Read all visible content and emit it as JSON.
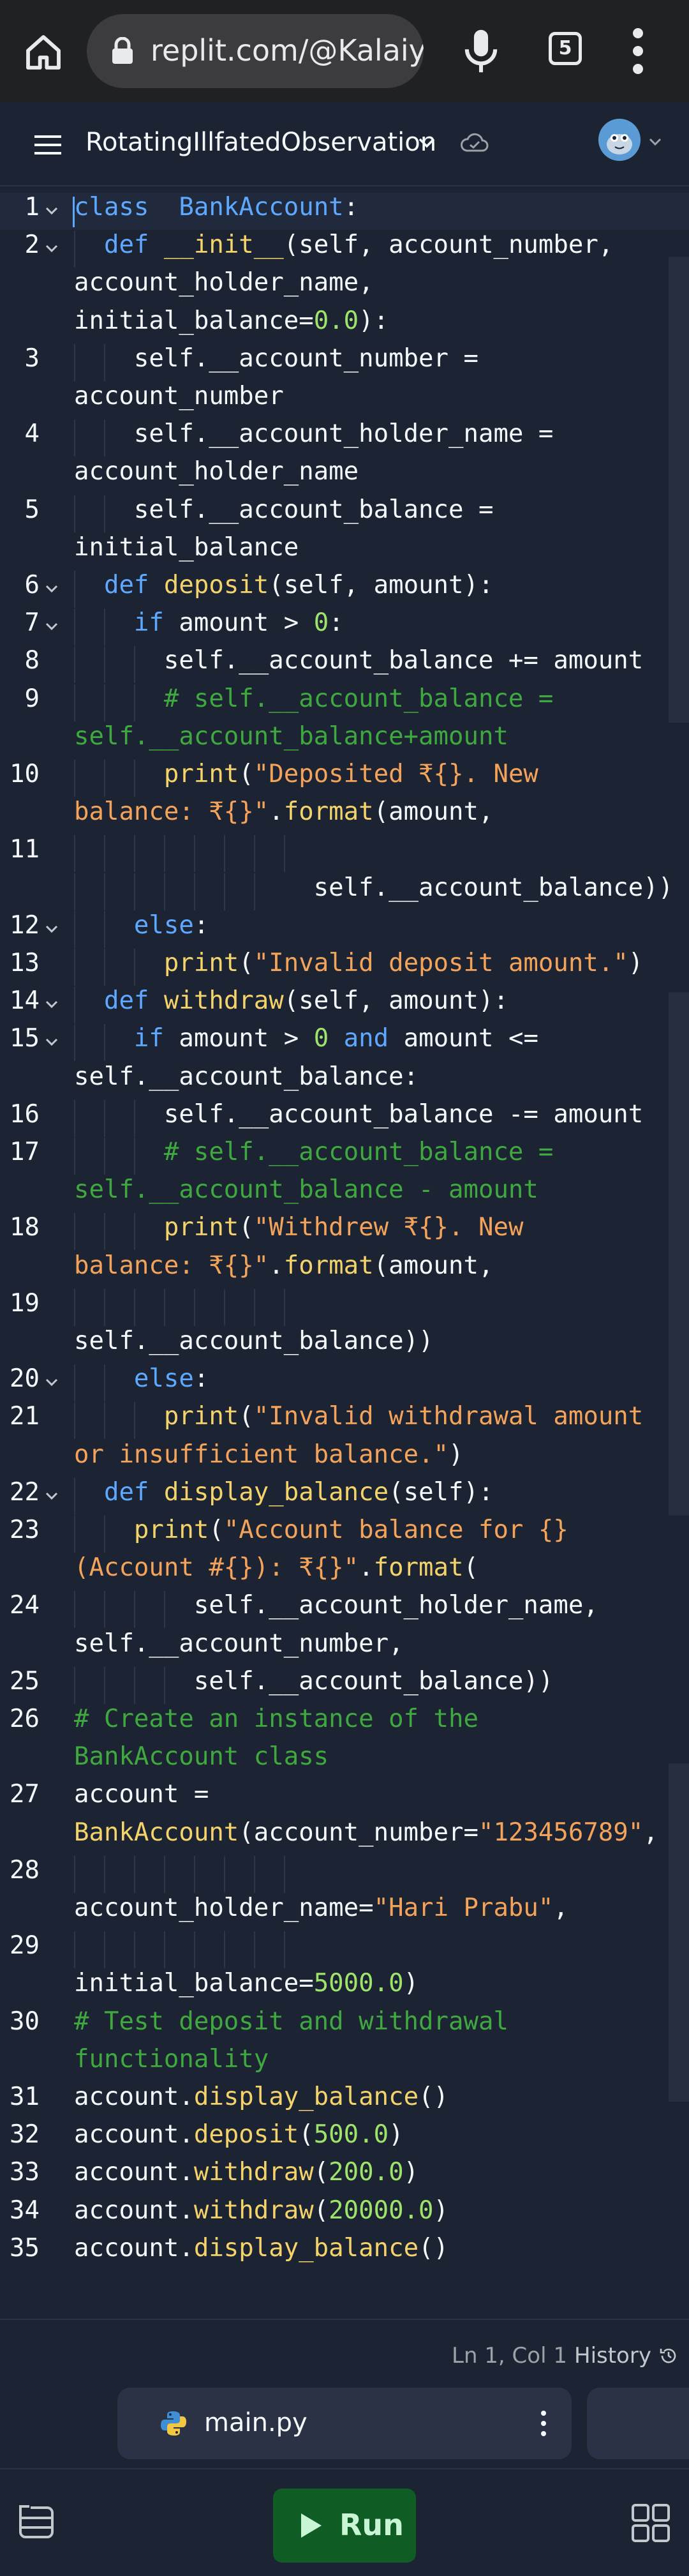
{
  "browser": {
    "url": "replit.com/@Kalaiya",
    "tab_count": "5",
    "icons": [
      "home-icon",
      "lock-icon",
      "mic-icon",
      "tabs-icon",
      "more-vert-icon"
    ]
  },
  "header": {
    "repl_name": "RotatingIllfatedObservation",
    "icons": [
      "hamburger-menu-icon",
      "chevron-down-icon",
      "cloud-sync-icon",
      "avatar"
    ]
  },
  "editor": {
    "lines": [
      {
        "n": "1",
        "fold": true,
        "indent": 0,
        "tokens": [
          [
            "kw",
            "class"
          ],
          [
            "",
            "  "
          ],
          [
            "cls",
            "BankAccount"
          ],
          [
            "",
            ":"
          ]
        ]
      },
      {
        "n": "2",
        "fold": true,
        "indent": 1,
        "tokens": [
          [
            "",
            "  "
          ],
          [
            "kw",
            "def"
          ],
          [
            "",
            " "
          ],
          [
            "fn",
            "__init__"
          ],
          [
            "",
            "(self, account_number,"
          ]
        ]
      },
      {
        "n": "",
        "fold": false,
        "indent": 0,
        "tokens": [
          [
            "",
            "account_holder_name,"
          ]
        ]
      },
      {
        "n": "",
        "fold": false,
        "indent": 0,
        "tokens": [
          [
            "",
            "initial_balance="
          ],
          [
            "num",
            "0.0"
          ],
          [
            "",
            "):"
          ]
        ]
      },
      {
        "n": "3",
        "fold": false,
        "indent": 2,
        "tokens": [
          [
            "",
            "    self.__account_number ="
          ]
        ]
      },
      {
        "n": "",
        "fold": false,
        "indent": 0,
        "tokens": [
          [
            "",
            "account_number"
          ]
        ]
      },
      {
        "n": "4",
        "fold": false,
        "indent": 2,
        "tokens": [
          [
            "",
            "    self.__account_holder_name ="
          ]
        ]
      },
      {
        "n": "",
        "fold": false,
        "indent": 0,
        "tokens": [
          [
            "",
            "account_holder_name"
          ]
        ]
      },
      {
        "n": "5",
        "fold": false,
        "indent": 2,
        "tokens": [
          [
            "",
            "    self.__account_balance ="
          ]
        ]
      },
      {
        "n": "",
        "fold": false,
        "indent": 0,
        "tokens": [
          [
            "",
            "initial_balance"
          ]
        ]
      },
      {
        "n": "6",
        "fold": true,
        "indent": 1,
        "tokens": [
          [
            "",
            "  "
          ],
          [
            "kw",
            "def"
          ],
          [
            "",
            " "
          ],
          [
            "fn",
            "deposit"
          ],
          [
            "",
            "(self, amount):"
          ]
        ]
      },
      {
        "n": "7",
        "fold": true,
        "indent": 2,
        "tokens": [
          [
            "",
            "    "
          ],
          [
            "kw",
            "if"
          ],
          [
            "",
            " amount > "
          ],
          [
            "num",
            "0"
          ],
          [
            "",
            ":"
          ]
        ]
      },
      {
        "n": "8",
        "fold": false,
        "indent": 3,
        "tokens": [
          [
            "",
            "      self.__account_balance += amount"
          ]
        ]
      },
      {
        "n": "9",
        "fold": false,
        "indent": 3,
        "tokens": [
          [
            "",
            "      "
          ],
          [
            "com",
            "# self.__account_balance ="
          ]
        ]
      },
      {
        "n": "",
        "fold": false,
        "indent": 0,
        "tokens": [
          [
            "com",
            "self.__account_balance+amount"
          ]
        ]
      },
      {
        "n": "10",
        "fold": false,
        "indent": 3,
        "tokens": [
          [
            "",
            "      "
          ],
          [
            "fn",
            "print"
          ],
          [
            "",
            "("
          ],
          [
            "str",
            "\"Deposited ₹{}. New"
          ]
        ]
      },
      {
        "n": "",
        "fold": false,
        "indent": 0,
        "tokens": [
          [
            "str",
            "balance: ₹{}\""
          ],
          [
            "",
            "."
          ],
          [
            "fn",
            "format"
          ],
          [
            "",
            "(amount,"
          ]
        ]
      },
      {
        "n": "11",
        "fold": false,
        "indent": 8,
        "tokens": []
      },
      {
        "n": "",
        "fold": false,
        "indent": 7,
        "tokens": [
          [
            "",
            "                self.__account_balance))"
          ]
        ]
      },
      {
        "n": "12",
        "fold": true,
        "indent": 2,
        "tokens": [
          [
            "",
            "    "
          ],
          [
            "kw",
            "else"
          ],
          [
            "",
            ":"
          ]
        ]
      },
      {
        "n": "13",
        "fold": false,
        "indent": 3,
        "tokens": [
          [
            "",
            "      "
          ],
          [
            "fn",
            "print"
          ],
          [
            "",
            "("
          ],
          [
            "str",
            "\"Invalid deposit amount.\""
          ],
          [
            "",
            ")"
          ]
        ]
      },
      {
        "n": "14",
        "fold": true,
        "indent": 1,
        "tokens": [
          [
            "",
            "  "
          ],
          [
            "kw",
            "def"
          ],
          [
            "",
            " "
          ],
          [
            "fn",
            "withdraw"
          ],
          [
            "",
            "(self, amount):"
          ]
        ]
      },
      {
        "n": "15",
        "fold": true,
        "indent": 2,
        "tokens": [
          [
            "",
            "    "
          ],
          [
            "kw",
            "if"
          ],
          [
            "",
            " amount > "
          ],
          [
            "num",
            "0"
          ],
          [
            "",
            " "
          ],
          [
            "kw",
            "and"
          ],
          [
            "",
            " amount <="
          ]
        ]
      },
      {
        "n": "",
        "fold": false,
        "indent": 0,
        "tokens": [
          [
            "",
            "self.__account_balance:"
          ]
        ]
      },
      {
        "n": "16",
        "fold": false,
        "indent": 3,
        "tokens": [
          [
            "",
            "      self.__account_balance -= amount"
          ]
        ]
      },
      {
        "n": "17",
        "fold": false,
        "indent": 3,
        "tokens": [
          [
            "",
            "      "
          ],
          [
            "com",
            "# self.__account_balance ="
          ]
        ]
      },
      {
        "n": "",
        "fold": false,
        "indent": 0,
        "tokens": [
          [
            "com",
            "self.__account_balance - amount"
          ]
        ]
      },
      {
        "n": "18",
        "fold": false,
        "indent": 3,
        "tokens": [
          [
            "",
            "      "
          ],
          [
            "fn",
            "print"
          ],
          [
            "",
            "("
          ],
          [
            "str",
            "\"Withdrew ₹{}. New"
          ]
        ]
      },
      {
        "n": "",
        "fold": false,
        "indent": 0,
        "tokens": [
          [
            "str",
            "balance: ₹{}\""
          ],
          [
            "",
            "."
          ],
          [
            "fn",
            "format"
          ],
          [
            "",
            "(amount,"
          ]
        ]
      },
      {
        "n": "19",
        "fold": false,
        "indent": 8,
        "tokens": []
      },
      {
        "n": "",
        "fold": false,
        "indent": 0,
        "tokens": [
          [
            "",
            "self.__account_balance))"
          ]
        ]
      },
      {
        "n": "20",
        "fold": true,
        "indent": 2,
        "tokens": [
          [
            "",
            "    "
          ],
          [
            "kw",
            "else"
          ],
          [
            "",
            ":"
          ]
        ]
      },
      {
        "n": "21",
        "fold": false,
        "indent": 3,
        "tokens": [
          [
            "",
            "      "
          ],
          [
            "fn",
            "print"
          ],
          [
            "",
            "("
          ],
          [
            "str",
            "\"Invalid withdrawal amount"
          ]
        ]
      },
      {
        "n": "",
        "fold": false,
        "indent": 0,
        "tokens": [
          [
            "str",
            "or insufficient balance.\""
          ],
          [
            "",
            ")"
          ]
        ]
      },
      {
        "n": "22",
        "fold": true,
        "indent": 1,
        "tokens": [
          [
            "",
            "  "
          ],
          [
            "kw",
            "def"
          ],
          [
            "",
            " "
          ],
          [
            "fn",
            "display_balance"
          ],
          [
            "",
            "(self):"
          ]
        ]
      },
      {
        "n": "23",
        "fold": false,
        "indent": 2,
        "tokens": [
          [
            "",
            "    "
          ],
          [
            "fn",
            "print"
          ],
          [
            "",
            "("
          ],
          [
            "str",
            "\"Account balance for {}"
          ]
        ]
      },
      {
        "n": "",
        "fold": false,
        "indent": 0,
        "tokens": [
          [
            "str",
            "(Account #{}): ₹{}\""
          ],
          [
            "",
            "."
          ],
          [
            "fn",
            "format"
          ],
          [
            "",
            "("
          ]
        ]
      },
      {
        "n": "24",
        "fold": false,
        "indent": 4,
        "tokens": [
          [
            "",
            "        self.__account_holder_name,"
          ]
        ]
      },
      {
        "n": "",
        "fold": false,
        "indent": 0,
        "tokens": [
          [
            "",
            "self.__account_number,"
          ]
        ]
      },
      {
        "n": "25",
        "fold": false,
        "indent": 4,
        "tokens": [
          [
            "",
            "        self.__account_balance))"
          ]
        ]
      },
      {
        "n": "26",
        "fold": false,
        "indent": 0,
        "tokens": [
          [
            "com",
            "# Create an instance of the"
          ]
        ]
      },
      {
        "n": "",
        "fold": false,
        "indent": 0,
        "tokens": [
          [
            "com",
            "BankAccount class"
          ]
        ]
      },
      {
        "n": "27",
        "fold": false,
        "indent": 0,
        "tokens": [
          [
            "",
            "account ="
          ]
        ]
      },
      {
        "n": "",
        "fold": false,
        "indent": 0,
        "tokens": [
          [
            "fn",
            "BankAccount"
          ],
          [
            "",
            "(account_number="
          ],
          [
            "str",
            "\"123456789\""
          ],
          [
            "",
            ","
          ]
        ]
      },
      {
        "n": "28",
        "fold": false,
        "indent": 8,
        "tokens": []
      },
      {
        "n": "",
        "fold": false,
        "indent": 0,
        "tokens": [
          [
            "",
            "account_holder_name="
          ],
          [
            "str",
            "\"Hari Prabu\""
          ],
          [
            "",
            ","
          ]
        ]
      },
      {
        "n": "29",
        "fold": false,
        "indent": 8,
        "tokens": []
      },
      {
        "n": "",
        "fold": false,
        "indent": 0,
        "tokens": [
          [
            "",
            "initial_balance="
          ],
          [
            "num",
            "5000.0"
          ],
          [
            "",
            ")"
          ]
        ]
      },
      {
        "n": "30",
        "fold": false,
        "indent": 0,
        "tokens": [
          [
            "com",
            "# Test deposit and withdrawal"
          ]
        ]
      },
      {
        "n": "",
        "fold": false,
        "indent": 0,
        "tokens": [
          [
            "com",
            "functionality"
          ]
        ]
      },
      {
        "n": "31",
        "fold": false,
        "indent": 0,
        "tokens": [
          [
            "",
            "account."
          ],
          [
            "fn",
            "display_balance"
          ],
          [
            "",
            "()"
          ]
        ]
      },
      {
        "n": "32",
        "fold": false,
        "indent": 0,
        "tokens": [
          [
            "",
            "account."
          ],
          [
            "fn",
            "deposit"
          ],
          [
            "",
            "("
          ],
          [
            "num",
            "500.0"
          ],
          [
            "",
            ")"
          ]
        ]
      },
      {
        "n": "33",
        "fold": false,
        "indent": 0,
        "tokens": [
          [
            "",
            "account."
          ],
          [
            "fn",
            "withdraw"
          ],
          [
            "",
            "("
          ],
          [
            "num",
            "200.0"
          ],
          [
            "",
            ")"
          ]
        ]
      },
      {
        "n": "34",
        "fold": false,
        "indent": 0,
        "tokens": [
          [
            "",
            "account."
          ],
          [
            "fn",
            "withdraw"
          ],
          [
            "",
            "("
          ],
          [
            "num",
            "20000.0"
          ],
          [
            "",
            ")"
          ]
        ]
      },
      {
        "n": "35",
        "fold": false,
        "indent": 0,
        "tokens": [
          [
            "",
            "account."
          ],
          [
            "fn",
            "display_balance"
          ],
          [
            "",
            "()"
          ]
        ]
      }
    ]
  },
  "status": {
    "position": "Ln 1, Col 1",
    "history_label": "History"
  },
  "file_tab": {
    "name": "main.py"
  },
  "bottom_bar": {
    "run_label": "Run"
  },
  "colors": {
    "background": "#1c2333",
    "keyword": "#5ea8ff",
    "function": "#f3d36a",
    "string": "#f3a35a",
    "number": "#9ee36a",
    "comment": "#3fa83f",
    "run_button": "#0f5c25"
  }
}
